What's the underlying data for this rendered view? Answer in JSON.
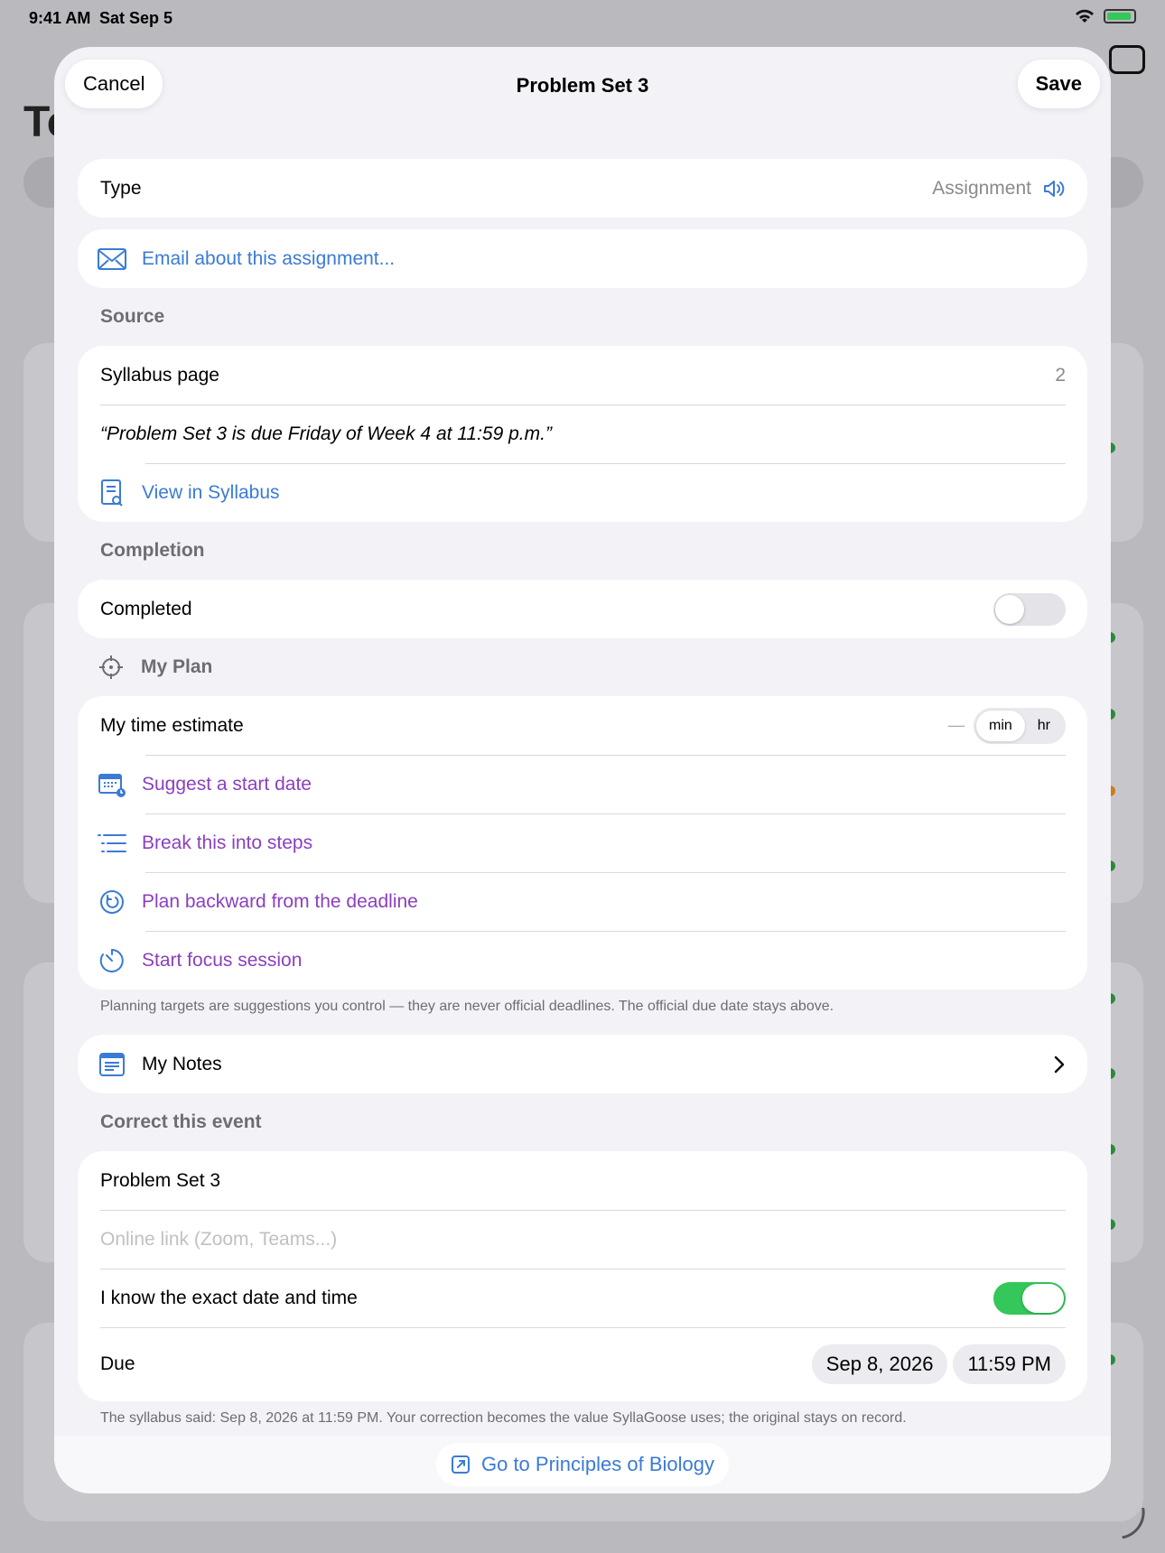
{
  "status": {
    "time": "9:41 AM",
    "date": "Sat Sep 5"
  },
  "background": {
    "title_fragment": "To"
  },
  "header": {
    "cancel": "Cancel",
    "title": "Problem Set 3",
    "save": "Save"
  },
  "type_row": {
    "label": "Type",
    "value": "Assignment"
  },
  "email_link": "Email about this assignment...",
  "source": {
    "header": "Source",
    "page_label": "Syllabus page",
    "page_value": "2",
    "quote": "“Problem Set 3 is due Friday of Week 4 at 11:59 p.m.”",
    "view_link": "View in Syllabus"
  },
  "completion": {
    "header": "Completion",
    "label": "Completed",
    "on": false
  },
  "plan": {
    "header": "My Plan",
    "time_label": "My time estimate",
    "time_value": "—",
    "units": [
      "min",
      "hr"
    ],
    "selected_unit": "min",
    "actions": [
      "Suggest a start date",
      "Break this into steps",
      "Plan backward from the deadline",
      "Start focus session"
    ],
    "footnote": "Planning targets are suggestions you control — they are never official deadlines. The official due date stays above."
  },
  "notes": {
    "label": "My Notes"
  },
  "correct": {
    "header": "Correct this event",
    "title_value": "Problem Set 3",
    "link_placeholder": "Online link (Zoom, Teams...)",
    "exact_label": "I know the exact date and time",
    "exact_on": true,
    "due_label": "Due",
    "due_date": "Sep 8, 2026",
    "due_time": "11:59 PM",
    "footnote": "The syllabus said: Sep 8, 2026 at 11:59 PM. Your correction becomes the value SyllaGoose uses; the original stays on record."
  },
  "bottom": {
    "goto": "Go to Principles of Biology"
  },
  "colors": {
    "accent_blue": "#3a7bd5",
    "accent_purple": "#8b3fbf",
    "toggle_on": "#34c759"
  }
}
